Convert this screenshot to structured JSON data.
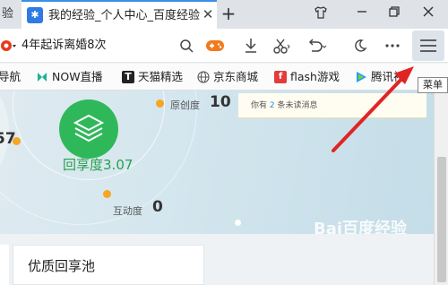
{
  "tabs": {
    "prev_tab_fragment": "验",
    "active": {
      "title": "我的经验_个人中心_百度经验",
      "favicon_glyph": "✱"
    },
    "new_tab_symbol": "+"
  },
  "window_controls": {
    "skin": "∂",
    "minimize": "—",
    "restore": "❐",
    "close": "✕"
  },
  "toolbar": {
    "address_text": "4年起诉离婚8次",
    "menu_tooltip": "菜单",
    "icons": [
      "search-icon",
      "game-icon",
      "download-icon",
      "scissors-icon",
      "undo-icon",
      "moon-icon",
      "more-icon",
      "menu-icon"
    ]
  },
  "bookmarks": [
    {
      "label": "导航",
      "color": "#3a8fe8"
    },
    {
      "label": "NOW直播",
      "color": "#1ab394"
    },
    {
      "label": "天猫精选",
      "color": "#e02020"
    },
    {
      "label": "京东商城",
      "color": "#555555"
    },
    {
      "label": "flash游戏",
      "color": "#e23c3c"
    },
    {
      "label": "腾讯视",
      "color": "#20a0ff"
    }
  ],
  "profile": {
    "left_value_fragment": "57",
    "originality_label": "原创度",
    "originality_value": "10",
    "enjoy_label": "回享度",
    "enjoy_value": "3.07",
    "interaction_label": "互动度",
    "interaction_value": "0"
  },
  "notice": {
    "prefix": "你有",
    "count": "2",
    "suffix": "条未读消息"
  },
  "section": {
    "title": "优质回享池"
  },
  "watermark": "Bai百度经验",
  "colors": {
    "accent": "#3a8fe8",
    "badge_green": "#2fb85a",
    "dot_orange": "#f5a623",
    "arrow_red": "#e02424"
  }
}
